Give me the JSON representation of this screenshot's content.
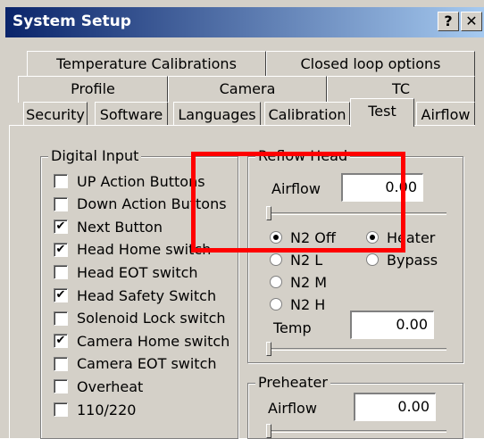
{
  "window": {
    "title": "System Setup",
    "help_label": "?",
    "close_label": "✕"
  },
  "tabs": {
    "row1": [
      "Temperature Calibrations",
      "Closed loop options"
    ],
    "row2": [
      "Profile",
      "Camera",
      "TC"
    ],
    "row3": [
      "Security",
      "Software",
      "Languages",
      "Calibration",
      "Test",
      "Airflow"
    ],
    "active": "Test"
  },
  "digital_input": {
    "title": "Digital Input",
    "items": [
      {
        "label": "UP Action Buttons",
        "checked": false
      },
      {
        "label": "Down Action Buttons",
        "checked": false
      },
      {
        "label": "Next Button",
        "checked": true
      },
      {
        "label": "Head Home switch",
        "checked": true
      },
      {
        "label": "Head EOT switch",
        "checked": false
      },
      {
        "label": "Head Safety Switch",
        "checked": true
      },
      {
        "label": "Solenoid Lock switch",
        "checked": false
      },
      {
        "label": "Camera Home switch",
        "checked": true
      },
      {
        "label": "Camera EOT switch",
        "checked": false
      },
      {
        "label": "Overheat",
        "checked": false
      },
      {
        "label": "110/220",
        "checked": false
      }
    ]
  },
  "reflow_head": {
    "title": "Reflow Head",
    "airflow_label": "Airflow",
    "airflow_value": "0.00",
    "radios_left": [
      {
        "label": "N2 Off",
        "selected": true
      },
      {
        "label": "N2 L",
        "selected": false
      },
      {
        "label": "N2 M",
        "selected": false
      },
      {
        "label": "N2 H",
        "selected": false
      }
    ],
    "radios_right": [
      {
        "label": "Heater",
        "selected": true
      },
      {
        "label": "Bypass",
        "selected": false
      }
    ],
    "temp_label": "Temp",
    "temp_value": "0.00"
  },
  "preheater": {
    "title": "Preheater",
    "airflow_label": "Airflow",
    "airflow_value": "0.00"
  },
  "highlight_color": "#ff0000",
  "check_mark": "✔"
}
